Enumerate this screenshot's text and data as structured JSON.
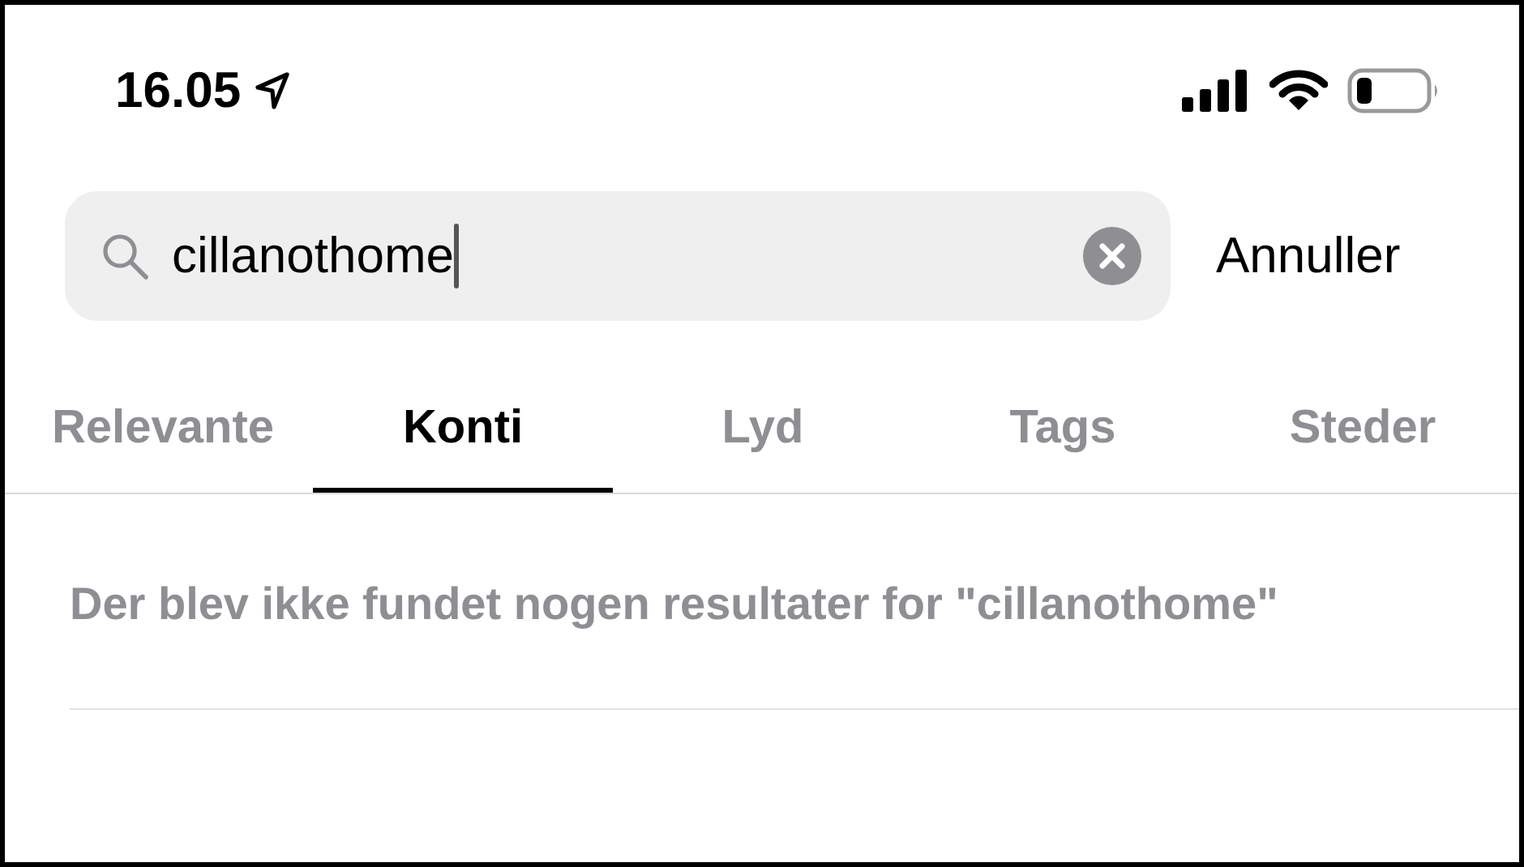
{
  "status_bar": {
    "time": "16.05"
  },
  "search": {
    "value": "cillanothome",
    "cancel": "Annuller"
  },
  "tabs": [
    {
      "label": "Relevante",
      "selected": false
    },
    {
      "label": "Konti",
      "selected": true
    },
    {
      "label": "Lyd",
      "selected": false
    },
    {
      "label": "Tags",
      "selected": false
    },
    {
      "label": "Steder",
      "selected": false
    }
  ],
  "message": "Der blev ikke fundet nogen resultater for \"cillanothome\""
}
